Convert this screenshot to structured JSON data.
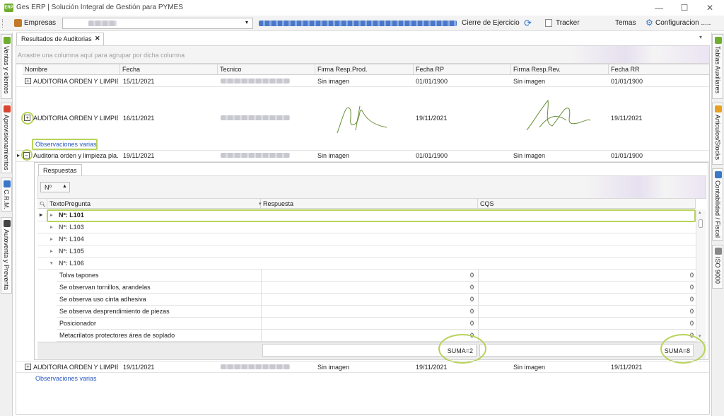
{
  "window": {
    "title": "Ges ERP | Solución Integral de Gestión para PYMES",
    "app_badge": "ERP",
    "minimize": "—",
    "maximize": "☐",
    "close": "✕"
  },
  "toolbar": {
    "empresas_label": "Empresas",
    "cierre_label": "Cierre de Ejercicio",
    "tracker_label": "Tracker",
    "temas_label": "Temas",
    "config_label": "Configuracion ....."
  },
  "left_tabs": [
    {
      "label": "Ventas y clientes",
      "color": "#6fae2e"
    },
    {
      "label": "Aprovisionamientos",
      "color": "#d9452e"
    },
    {
      "label": "C.R.M.",
      "color": "#3a78c8"
    },
    {
      "label": "Autoventa y Preventa",
      "color": "#444444"
    }
  ],
  "right_tabs": [
    {
      "label": "Tablas Auxiliares",
      "color": "#6fae2e"
    },
    {
      "label": "Articulos/Stocks",
      "color": "#e8a020"
    },
    {
      "label": "Contabilidad / Fiscal",
      "color": "#3a78c8"
    },
    {
      "label": "ISO 9000",
      "color": "#888888"
    }
  ],
  "document_tab": {
    "label": "Resultados de Auditorias",
    "close": "✕"
  },
  "group_hint": "Arrastre una columna aquí para agrupar por dicha columna",
  "columns": [
    "Nombre",
    "Fecha",
    "Tecnico",
    "Firma Resp.Prod.",
    "Fecha RP",
    "Firma Resp.Rev.",
    "Fecha RR"
  ],
  "rows": [
    {
      "expander": "+",
      "nombre": "AUDITORIA ORDEN Y LIMPIE...",
      "fecha": "15/11/2021",
      "firma_rp": "Sin imagen",
      "fecha_rp": "01/01/1900",
      "firma_rr": "Sin imagen",
      "fecha_rr": "01/01/1900"
    },
    {
      "expander": "+",
      "nombre": "AUDITORIA ORDEN Y LIMPIE...",
      "fecha": "16/11/2021",
      "firma_rp": "",
      "fecha_rp": "19/11/2021",
      "firma_rr": "",
      "fecha_rr": "19/11/2021",
      "observaciones": "Observaciones varias"
    },
    {
      "expander": "−",
      "nombre": "Auditoria orden y limpieza pla...",
      "fecha": "19/11/2021",
      "firma_rp": "Sin imagen",
      "fecha_rp": "01/01/1900",
      "firma_rr": "Sin imagen",
      "fecha_rr": "01/01/1900"
    },
    {
      "expander": "+",
      "nombre": "AUDITORIA ORDEN Y LIMPIE...",
      "fecha": "19/11/2021",
      "firma_rp": "Sin imagen",
      "fecha_rp": "19/11/2021",
      "firma_rr": "Sin imagen",
      "fecha_rr": "19/11/2021",
      "observaciones": "Observaciones varias"
    }
  ],
  "detail": {
    "tab_label": "Respuestas",
    "sort_chip": "Nº",
    "columns": [
      "TextoPregunta",
      "Respuesta",
      "CQS"
    ],
    "groups": [
      "Nº: L101",
      "Nº: L103",
      "Nº: L104",
      "Nº: L105",
      "Nº: L106"
    ],
    "items": [
      {
        "texto": "Tolva tapones",
        "respuesta": "0",
        "cqs": "0"
      },
      {
        "texto": "Se observan tornillos, arandelas",
        "respuesta": "0",
        "cqs": "0"
      },
      {
        "texto": "Se observa uso cinta adhesiva",
        "respuesta": "0",
        "cqs": "0"
      },
      {
        "texto": "Se observa desprendimiento de piezas",
        "respuesta": "0",
        "cqs": "0"
      },
      {
        "texto": "Posicionador",
        "respuesta": "0",
        "cqs": "0"
      },
      {
        "texto": "Metacrilatos protectores área de soplado",
        "respuesta": "0",
        "cqs": "0"
      }
    ],
    "sum_respuesta": "SUMA=2",
    "sum_cqs": "SUMA=8"
  }
}
